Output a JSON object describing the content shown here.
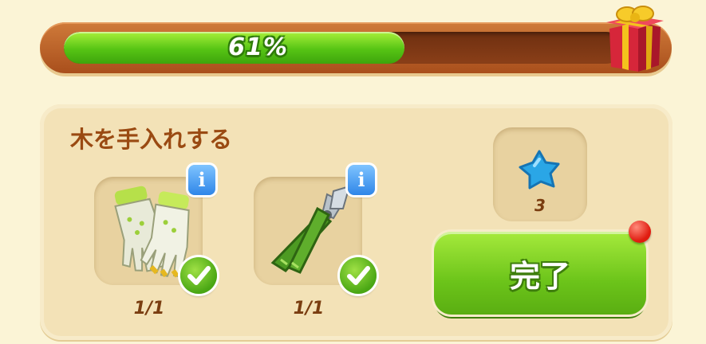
{
  "progress": {
    "percent": 0.61,
    "label": "61%"
  },
  "task": {
    "title": "木を手入れする",
    "items": [
      {
        "name": "gardening-gloves",
        "count": "1/1",
        "completed": true
      },
      {
        "name": "pruning-shears",
        "count": "1/1",
        "completed": true
      }
    ],
    "reward": {
      "icon": "blue-star-icon",
      "amount": "3"
    },
    "complete_label": "完了"
  },
  "colors": {
    "progress_fill": "#56c414",
    "frame": "#b85a22",
    "title_text": "#9a4a12",
    "button": "#6cc41a"
  }
}
